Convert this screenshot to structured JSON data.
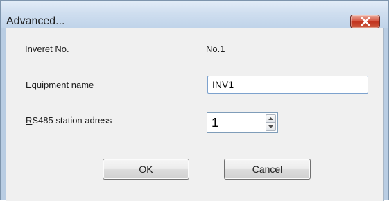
{
  "window": {
    "title": "Advanced...",
    "close_icon": "close-x-icon",
    "accent_color": "#c7402b"
  },
  "form": {
    "inverter_no_label": "Inveret No.",
    "inverter_no_value": "No.1",
    "equipment_name_label_accel": "E",
    "equipment_name_label_rest": "quipment name",
    "equipment_name_value": "INV1",
    "rs485_label_accel": "R",
    "rs485_label_rest": "S485 station adress",
    "rs485_value": "1"
  },
  "buttons": {
    "ok_label": "OK",
    "cancel_label": "Cancel"
  }
}
